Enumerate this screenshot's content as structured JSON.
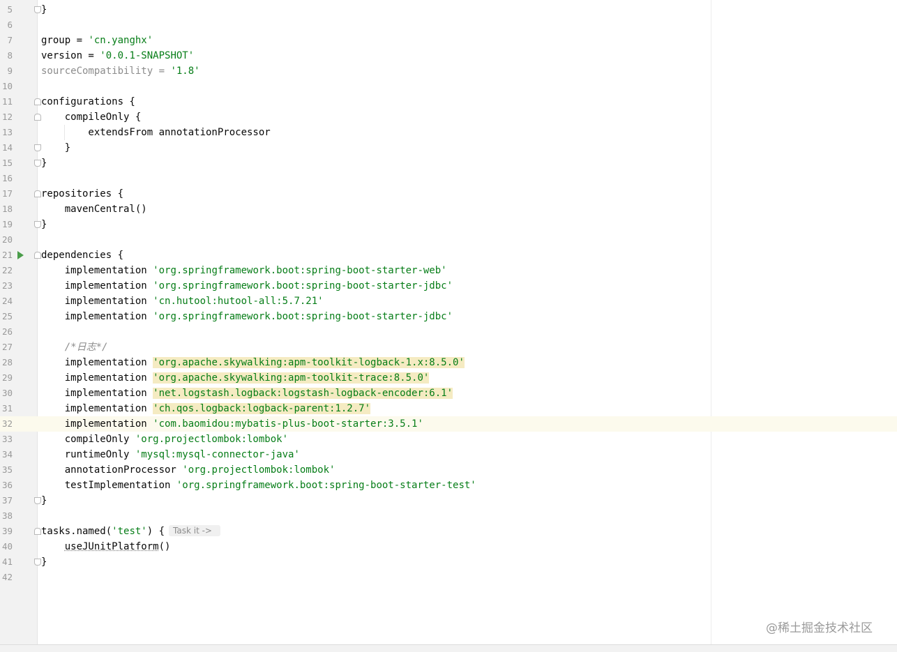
{
  "editor": {
    "lines": {
      "l5": {
        "num": "5",
        "code": "}"
      },
      "l6": {
        "num": "6"
      },
      "l7": {
        "num": "7",
        "pre": "group = ",
        "str": "'cn.yanghx'"
      },
      "l8": {
        "num": "8",
        "pre": "version = ",
        "str": "'0.0.1-SNAPSHOT'"
      },
      "l9": {
        "num": "9",
        "pre": "sourceCompatibility = ",
        "str": "'1.8'"
      },
      "l10": {
        "num": "10"
      },
      "l11": {
        "num": "11",
        "code": "configurations {"
      },
      "l12": {
        "num": "12",
        "code": "    compileOnly {"
      },
      "l13": {
        "num": "13",
        "code": "        extendsFrom annotationProcessor"
      },
      "l14": {
        "num": "14",
        "code": "    }"
      },
      "l15": {
        "num": "15",
        "code": "}"
      },
      "l16": {
        "num": "16"
      },
      "l17": {
        "num": "17",
        "code": "repositories {"
      },
      "l18": {
        "num": "18",
        "code": "    mavenCentral()"
      },
      "l19": {
        "num": "19",
        "code": "}"
      },
      "l20": {
        "num": "20"
      },
      "l21": {
        "num": "21",
        "code": "dependencies {"
      },
      "l22": {
        "num": "22",
        "pre": "    implementation ",
        "str": "'org.springframework.boot:spring-boot-starter-web'"
      },
      "l23": {
        "num": "23",
        "pre": "    implementation ",
        "str": "'org.springframework.boot:spring-boot-starter-jdbc'"
      },
      "l24": {
        "num": "24",
        "pre": "    implementation ",
        "str": "'cn.hutool:hutool-all:5.7.21'"
      },
      "l25": {
        "num": "25",
        "pre": "    implementation ",
        "str": "'org.springframework.boot:spring-boot-starter-jdbc'"
      },
      "l26": {
        "num": "26"
      },
      "l27": {
        "num": "27",
        "pre": "    ",
        "comment": "/*日志*/"
      },
      "l28": {
        "num": "28",
        "pre": "    implementation ",
        "str": "'org.apache.skywalking:apm-toolkit-logback-1.x:8.5.0'"
      },
      "l29": {
        "num": "29",
        "pre": "    implementation ",
        "str": "'org.apache.skywalking:apm-toolkit-trace:8.5.0'"
      },
      "l30": {
        "num": "30",
        "pre": "    implementation ",
        "str": "'net.logstash.logback:logstash-logback-encoder:6.1'"
      },
      "l31": {
        "num": "31",
        "pre": "    implementation ",
        "str": "'ch.qos.logback:logback-parent:1.2.7'"
      },
      "l32": {
        "num": "32",
        "pre": "    implementation ",
        "str": "'com.baomidou:mybatis-plus-boot-starter:3.5.1'"
      },
      "l33": {
        "num": "33",
        "pre": "    compileOnly ",
        "str": "'org.projectlombok:lombok'"
      },
      "l34": {
        "num": "34",
        "pre": "    runtimeOnly ",
        "str": "'mysql:mysql-connector-java'"
      },
      "l35": {
        "num": "35",
        "pre": "    annotationProcessor ",
        "str": "'org.projectlombok:lombok'"
      },
      "l36": {
        "num": "36",
        "pre": "    testImplementation ",
        "str": "'org.springframework.boot:spring-boot-starter-test'"
      },
      "l37": {
        "num": "37",
        "code": "}"
      },
      "l38": {
        "num": "38"
      },
      "l39": {
        "num": "39",
        "pre": "tasks.named(",
        "str": "'test'",
        "post": ") {",
        "hint": "Task it ->"
      },
      "l40": {
        "num": "40",
        "pre": "    ",
        "warn": "useJUnitPlatform",
        "post": "()"
      },
      "l41": {
        "num": "41",
        "code": "}"
      },
      "l42": {
        "num": "42"
      }
    }
  },
  "watermark": "@稀土掘金技术社区",
  "colors": {
    "string": "#067d17",
    "comment": "#8c8c8c",
    "highlight": "#f5ebc2",
    "current_line": "#fcfaed",
    "run_icon": "#4a9d4a"
  }
}
